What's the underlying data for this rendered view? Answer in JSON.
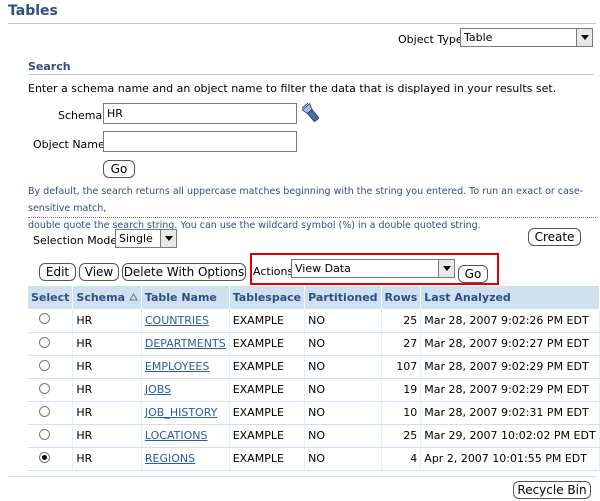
{
  "page": {
    "title": "Tables"
  },
  "object_type": {
    "label": "Object Type",
    "value": "Table"
  },
  "search": {
    "heading": "Search",
    "instruction": "Enter a schema name and an object name to filter the data that is displayed in your results set.",
    "schema_label": "Schema",
    "schema_value": "HR",
    "object_name_label": "Object Name",
    "object_name_value": "",
    "go_label": "Go",
    "hint_line1": "By default, the search returns all uppercase matches beginning with the string you entered. To run an exact or case-sensitive match,",
    "hint_line2": "double quote the search string. You can use the wildcard symbol (%) in a double quoted string."
  },
  "selection_mode": {
    "label": "Selection Mode",
    "value": "Single"
  },
  "create_label": "Create",
  "toolbar": {
    "edit_label": "Edit",
    "view_label": "View",
    "delete_label": "Delete With Options",
    "actions_label": "Actions",
    "actions_value": "View Data",
    "go_label": "Go"
  },
  "table": {
    "headers": [
      "Select",
      "Schema",
      "Table Name",
      "Tablespace",
      "Partitioned",
      "Rows",
      "Last Analyzed"
    ],
    "rows": [
      {
        "schema": "HR",
        "name": "COUNTRIES",
        "tablespace": "EXAMPLE",
        "partitioned": "NO",
        "rows": "25",
        "analyzed": "Mar 28, 2007 9:02:26 PM EDT",
        "selected": false
      },
      {
        "schema": "HR",
        "name": "DEPARTMENTS",
        "tablespace": "EXAMPLE",
        "partitioned": "NO",
        "rows": "27",
        "analyzed": "Mar 28, 2007 9:02:27 PM EDT",
        "selected": false
      },
      {
        "schema": "HR",
        "name": "EMPLOYEES",
        "tablespace": "EXAMPLE",
        "partitioned": "NO",
        "rows": "107",
        "analyzed": "Mar 28, 2007 9:02:29 PM EDT",
        "selected": false
      },
      {
        "schema": "HR",
        "name": "JOBS",
        "tablespace": "EXAMPLE",
        "partitioned": "NO",
        "rows": "19",
        "analyzed": "Mar 28, 2007 9:02:29 PM EDT",
        "selected": false
      },
      {
        "schema": "HR",
        "name": "JOB_HISTORY",
        "tablespace": "EXAMPLE",
        "partitioned": "NO",
        "rows": "10",
        "analyzed": "Mar 28, 2007 9:02:31 PM EDT",
        "selected": false
      },
      {
        "schema": "HR",
        "name": "LOCATIONS",
        "tablespace": "EXAMPLE",
        "partitioned": "NO",
        "rows": "25",
        "analyzed": "Mar 29, 2007 10:02:02 PM EDT",
        "selected": false
      },
      {
        "schema": "HR",
        "name": "REGIONS",
        "tablespace": "EXAMPLE",
        "partitioned": "NO",
        "rows": "4",
        "analyzed": "Apr 2, 2007 10:01:55 PM EDT",
        "selected": true
      }
    ]
  },
  "recycle_bin_label": "Recycle Bin",
  "colors": {
    "heading": "#2f4f7f",
    "header_bg": "#cfe0f1",
    "link": "#2a5aa8",
    "highlight": "#e00000"
  }
}
